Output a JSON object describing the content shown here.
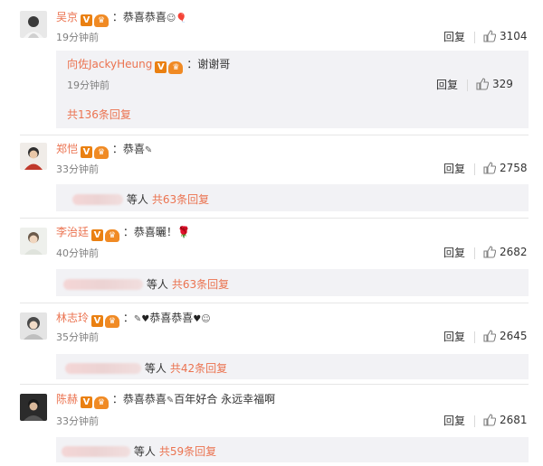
{
  "comments": [
    {
      "user": "吴京",
      "text": "：恭喜恭喜",
      "time": "19分钟前",
      "reply": "回复",
      "likes": "3104",
      "subreply": {
        "user": "向佐JackyHeung",
        "text": "：谢谢哥",
        "time": "19分钟前",
        "reply": "回复",
        "likes": "329"
      },
      "more": "共136条回复"
    },
    {
      "user": "郑恺",
      "text": "：恭喜",
      "time": "33分钟前",
      "reply": "回复",
      "likes": "2758",
      "etc": "等人",
      "more": "共63条回复"
    },
    {
      "user": "李治廷",
      "text": "：恭喜曬！",
      "time": "40分钟前",
      "reply": "回复",
      "likes": "2682",
      "etc": "等人",
      "more": "共63条回复"
    },
    {
      "user": "林志玲",
      "text": "：",
      "text2": "恭喜恭喜",
      "time": "35分钟前",
      "reply": "回复",
      "likes": "2645",
      "etc": "等人",
      "more": "共42条回复"
    },
    {
      "user": "陈赫",
      "text": "：恭喜恭喜",
      "text2": "百年好合 永远幸福啊",
      "time": "33分钟前",
      "reply": "回复",
      "likes": "2681",
      "etc": "等人",
      "more": "共59条回复"
    }
  ],
  "colors": {
    "username": "#eb7350",
    "vip_badge": "#ea8011",
    "subbox_bg": "#f2f2f5",
    "time": "#808080"
  }
}
